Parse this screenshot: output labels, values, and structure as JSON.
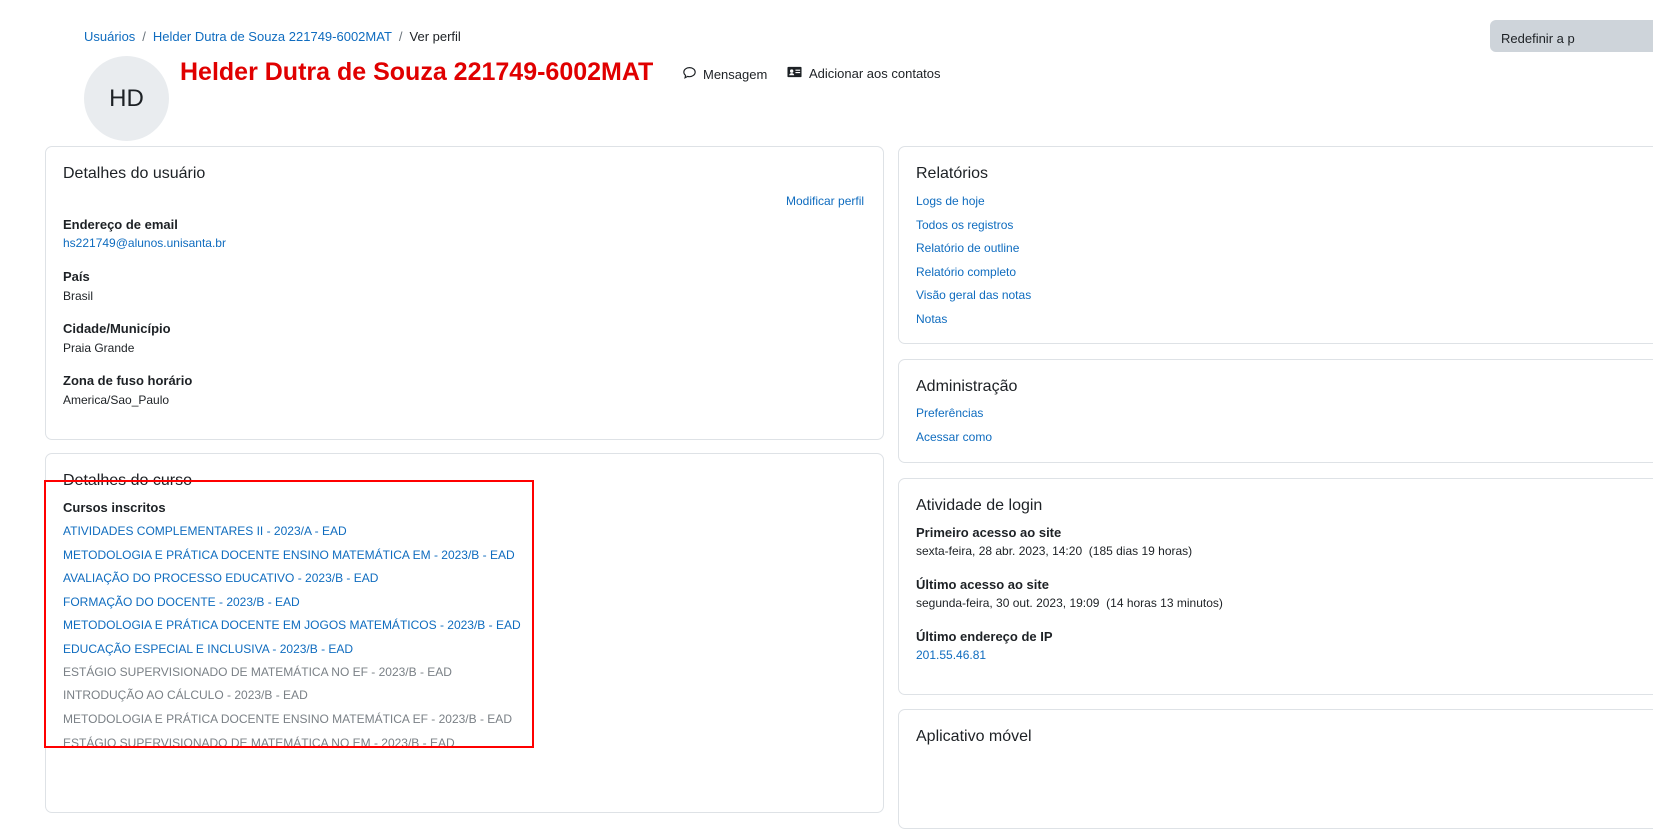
{
  "breadcrumb": {
    "items": [
      "Usuários",
      "Helder Dutra de Souza 221749-6002MAT",
      "Ver perfil"
    ]
  },
  "header": {
    "reset_label": "Redefinir a p",
    "avatar_initials": "HD",
    "name": "Helder Dutra de Souza 221749-6002MAT",
    "message_label": "Mensagem",
    "add_contact_label": "Adicionar aos contatos"
  },
  "user_details": {
    "title": "Detalhes do usuário",
    "edit_label": "Modificar perfil",
    "fields": [
      {
        "label": "Endereço de email",
        "value": "hs221749@alunos.unisanta.br"
      },
      {
        "label": "País",
        "value": "Brasil"
      },
      {
        "label": "Cidade/Município",
        "value": "Praia Grande"
      },
      {
        "label": "Zona de fuso horário",
        "value": "America/Sao_Paulo"
      }
    ]
  },
  "course_details": {
    "title": "Detalhes do curso",
    "enrolled_label": "Cursos inscritos",
    "courses": [
      "ATIVIDADES COMPLEMENTARES II - 2023/A - EAD",
      "METODOLOGIA E PRÁTICA DOCENTE ENSINO MATEMÁTICA EM - 2023/B - EAD",
      "AVALIAÇÃO DO PROCESSO EDUCATIVO - 2023/B - EAD",
      "FORMAÇÃO DO DOCENTE - 2023/B - EAD",
      "METODOLOGIA E PRÁTICA DOCENTE EM JOGOS MATEMÁTICOS - 2023/B - EAD",
      "EDUCAÇÃO ESPECIAL E INCLUSIVA - 2023/B - EAD",
      "ESTÁGIO SUPERVISIONADO DE MATEMÁTICA NO EF - 2023/B - EAD",
      "INTRODUÇÃO AO CÁLCULO - 2023/B - EAD",
      "METODOLOGIA E PRÁTICA DOCENTE ENSINO MATEMÁTICA EF - 2023/B - EAD",
      "ESTÁGIO SUPERVISIONADO DE MATEMÁTICA NO EM - 2023/B - EAD"
    ]
  },
  "reports": {
    "title": "Relatórios",
    "links": [
      "Logs de hoje",
      "Todos os registros",
      "Relatório de outline",
      "Relatório completo",
      "Visão geral das notas",
      "Notas"
    ]
  },
  "administration": {
    "title": "Administração",
    "links": [
      "Preferências",
      "Acessar como"
    ]
  },
  "login_activity": {
    "title": "Atividade de login",
    "first_access_label": "Primeiro acesso ao site",
    "first_access_value": "sexta-feira, 28 abr. 2023, 14:20  (185 dias 19 horas)",
    "last_access_label": "Último acesso ao site",
    "last_access_value": "segunda-feira, 30 out. 2023, 19:09  (14 horas 13 minutos)",
    "last_ip_label": "Último endereço de IP",
    "last_ip_value": "201.55.46.81"
  },
  "mobile_app": {
    "title": "Aplicativo móvel"
  },
  "colors": {
    "link": "#0f6cbf",
    "title": "#e00000",
    "highlight": "#ff0000",
    "border": "#dee2e6"
  }
}
